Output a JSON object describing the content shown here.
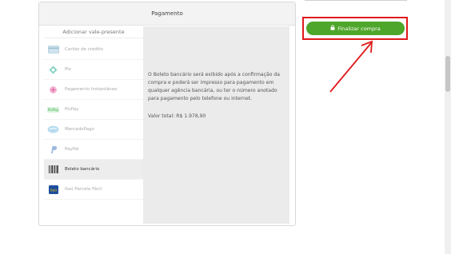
{
  "panel": {
    "title": "Pagamento",
    "gift_card_label": "Adicionar vale-presente",
    "methods": [
      {
        "label": "Cartão de crédito",
        "icon": "credit-card-icon"
      },
      {
        "label": "Pix",
        "icon": "pix-icon"
      },
      {
        "label": "Pagamento Instantâneo",
        "icon": "instant-payment-icon"
      },
      {
        "label": "PicPay",
        "icon": "picpay-icon"
      },
      {
        "label": "MercadoPago",
        "icon": "mercadopago-icon"
      },
      {
        "label": "PayPal",
        "icon": "paypal-icon"
      },
      {
        "label": "Boleto bancário",
        "icon": "barcode-icon",
        "selected": true
      },
      {
        "label": "Itaú Parcela Fácil",
        "icon": "itau-icon"
      }
    ],
    "detail": {
      "description": "O Boleto bancário será exibido após a confirmação da compra e poderá ser impresso para pagamento em qualquer agência bancária, ou ter o número anotado para pagamento pelo telefone ou internet.",
      "total": "Valor total: R$ 1.978,90"
    }
  },
  "finalize_button": {
    "label": "Finalizar compra",
    "icon": "lock-icon",
    "color": "#4ea62a"
  },
  "annotation": {
    "color": "#e01a1a"
  }
}
